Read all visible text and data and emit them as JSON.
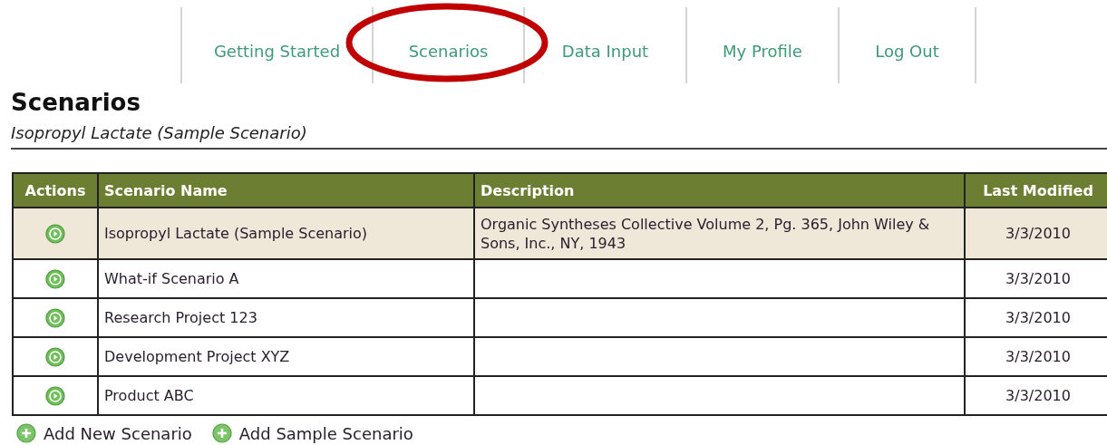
{
  "nav": {
    "tabs": [
      {
        "label": "Getting Started",
        "highlighted": false
      },
      {
        "label": "Scenarios",
        "highlighted": true
      },
      {
        "label": "Data Input",
        "highlighted": false
      },
      {
        "label": "My Profile",
        "highlighted": false
      },
      {
        "label": "Log Out",
        "highlighted": false
      }
    ]
  },
  "page": {
    "title": "Scenarios",
    "subtitle": "Isopropyl Lactate (Sample Scenario)"
  },
  "table": {
    "columns": [
      "Actions",
      "Scenario Name",
      "Description",
      "Last Modified"
    ],
    "rows": [
      {
        "selected": true,
        "name": "Isopropyl Lactate (Sample Scenario)",
        "description": "Organic Syntheses Collective Volume 2, Pg. 365, John Wiley & Sons, Inc., NY, 1943",
        "last_modified": "3/3/2010"
      },
      {
        "selected": false,
        "name": "What-if Scenario A",
        "last_modified": "3/3/2010"
      },
      {
        "selected": false,
        "name": "Research Project 123",
        "last_modified": "3/3/2010"
      },
      {
        "selected": false,
        "name": "Development Project XYZ",
        "last_modified": "3/3/2010"
      },
      {
        "selected": false,
        "name": "Product ABC",
        "last_modified": "3/3/2010"
      }
    ]
  },
  "actions": [
    "Add New Scenario",
    "Add Sample Scenario"
  ]
}
